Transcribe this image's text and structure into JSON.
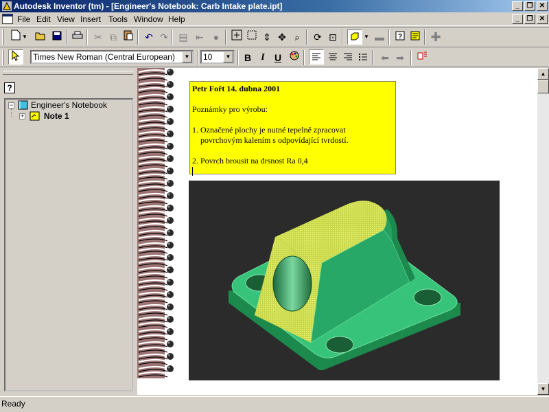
{
  "window": {
    "title": "Autodesk Inventor (tm) - [Engineer's Notebook: Carb Intake plate.ipt]",
    "buttons": [
      "_",
      "❐",
      "✕"
    ]
  },
  "menubar": {
    "items": [
      "File",
      "Edit",
      "View",
      "Insert",
      "Tools",
      "Window",
      "Help"
    ]
  },
  "format_toolbar": {
    "font_name": "Times New Roman (Central European)",
    "font_size": "10",
    "bold": "B",
    "italic": "I",
    "underline": "U"
  },
  "browser": {
    "help_icon": "?",
    "root_label": "Engineer's Notebook",
    "note_label": "Note 1",
    "expand_root": "−",
    "expand_note": "+"
  },
  "note": {
    "header": "Petr Fořt 14. dubna 2001",
    "intro": "Poznámky pro výrobu:",
    "item1_line1": "1. Označené plochy je nutné tepelně zpracovat",
    "item1_line2": "povrchovým kalením s odpovídající tvrdostí.",
    "item2": "2. Povrch brousit na drsnost Ra 0,4",
    "background_color": "#ffff00"
  },
  "status": {
    "text": "Ready"
  }
}
